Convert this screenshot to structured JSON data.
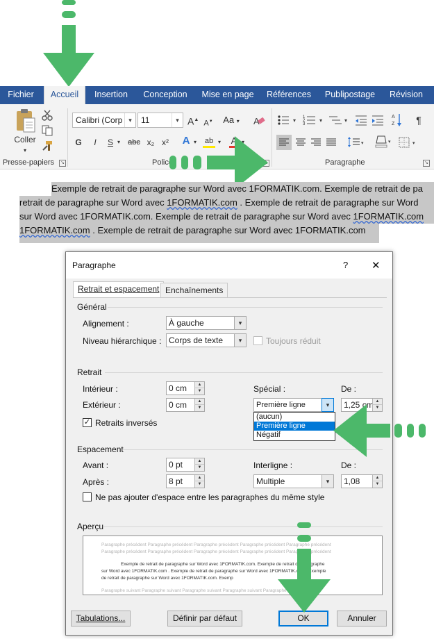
{
  "ribbon": {
    "tabs": [
      "Fichier",
      "Accueil",
      "Insertion",
      "Conception",
      "Mise en page",
      "Références",
      "Publipostage",
      "Révision"
    ],
    "active_tab": "Accueil",
    "clipboard": {
      "paste_label": "Coller",
      "group_label": "Presse-papiers"
    },
    "font": {
      "font_name": "Calibri (Corp",
      "font_size": "11",
      "grow": "A",
      "shrink": "A",
      "case": "Aa",
      "bold": "G",
      "italic": "I",
      "underline": "S",
      "strike": "abc",
      "subscript": "x₂",
      "superscript": "x²",
      "effects": "A",
      "highlight": "ab",
      "font_color": "A",
      "group_label": "Police"
    },
    "paragraph": {
      "group_label": "Paragraphe",
      "show_marks": "¶"
    }
  },
  "document": {
    "line1": "Exemple de retrait de paragraphe sur Word avec 1FORMATIK.com. Exemple de retrait de pa",
    "line2a": "retrait de paragraphe sur Word avec ",
    "line2b": "1FORMATIK.com",
    "line2c": " . Exemple de retrait de paragraphe sur Word",
    "line3a": "sur Word avec 1FORMATIK.com. Exemple de retrait de paragraphe sur Word avec ",
    "line3b": "1FORMATIK.com",
    "line4a": "1FORMATIK.com",
    "line4b": " . Exemple de retrait de paragraphe sur Word avec 1FORMATIK.com"
  },
  "dialog": {
    "title": "Paragraphe",
    "help": "?",
    "close": "✕",
    "tabs": [
      "Retrait et espacement",
      "Enchaînements"
    ],
    "general": {
      "section": "Général",
      "alignment_label": "Alignement :",
      "alignment_value": "À gauche",
      "level_label": "Niveau hiérarchique :",
      "level_value": "Corps de texte",
      "collapsed_label": "Toujours réduit"
    },
    "indent": {
      "section": "Retrait",
      "left_label": "Intérieur :",
      "left_value": "0 cm",
      "right_label": "Extérieur :",
      "right_value": "0 cm",
      "special_label": "Spécial :",
      "special_value": "Première ligne",
      "by_label": "De :",
      "by_value": "1,25 cm",
      "mirror_label": "Retraits inversés",
      "mirror_checked": true,
      "special_options": [
        "(aucun)",
        "Première ligne",
        "Négatif"
      ],
      "special_selected": "Première ligne"
    },
    "spacing": {
      "section": "Espacement",
      "before_label": "Avant :",
      "before_value": "0 pt",
      "after_label": "Après :",
      "after_value": "8 pt",
      "line_label": "Interligne :",
      "line_value": "Multiple",
      "at_label": "De :",
      "at_value": "1,08",
      "no_space_label": "Ne pas ajouter d'espace entre les paragraphes du même style"
    },
    "preview": {
      "section": "Aperçu",
      "prev1": "Paragraphe précédent Paragraphe précédent Paragraphe précédent Paragraphe précédent Paragraphe précédent",
      "prev2": "Paragraphe précédent Paragraphe précédent Paragraphe précédent Paragraphe précédent Paragraphe précédent",
      "sample1": "Exemple de retrait de paragraphe sur Word avec 1FORMATIK.com. Exemple de retrait de paragraphe",
      "sample2": "sur Word avec 1FORMATIK.com . Exemple de retrait de paragraphe sur Word avec 1FORMATIK.com . Exemple",
      "sample3": "de retrait de paragraphe sur Word avec 1FORMATIK.com. Exemp",
      "next1": "Paragraphe suivant Paragraphe suivant Paragraphe suivant Paragraphe suivant Paragraphe suivant"
    },
    "buttons": {
      "tabs": "Tabulations...",
      "default": "Définir par défaut",
      "ok": "OK",
      "cancel": "Annuler"
    }
  },
  "annotations": {
    "arrow_color": "#4cb86a"
  }
}
